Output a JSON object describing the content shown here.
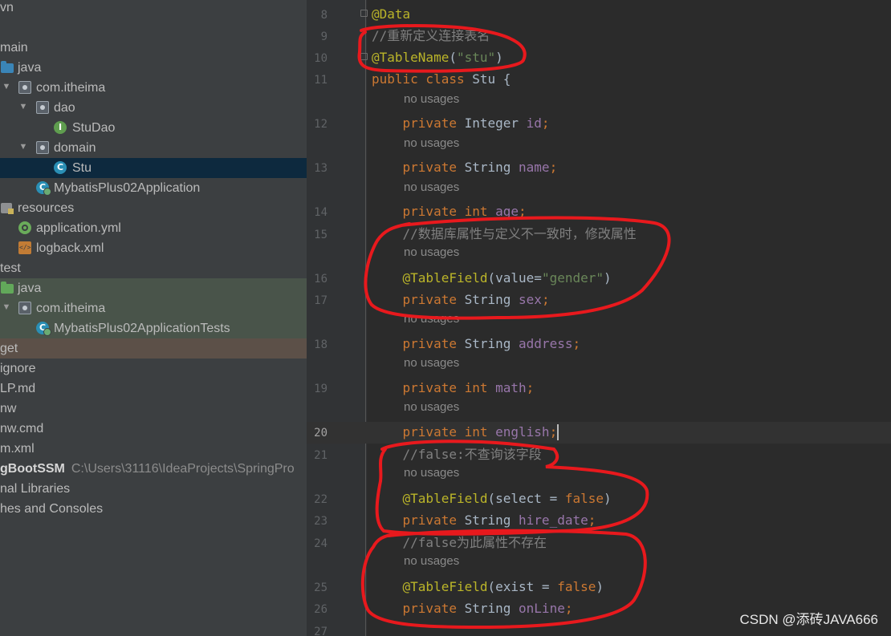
{
  "project_tree": {
    "items": [
      {
        "label": "vn",
        "indent": 0,
        "icon": "none"
      },
      {
        "label": "main",
        "indent": 0,
        "icon": "none"
      },
      {
        "label": "java",
        "icon": "folder-blue-icon"
      },
      {
        "label": "com.itheima",
        "icon": "package-icon"
      },
      {
        "label": "dao",
        "icon": "package-icon"
      },
      {
        "label": "StuDao",
        "icon": "interface-icon",
        "badge": "I"
      },
      {
        "label": "domain",
        "icon": "package-icon"
      },
      {
        "label": "Stu",
        "icon": "class-icon",
        "badge": "C"
      },
      {
        "label": "MybatisPlus02Application",
        "icon": "spring-app-icon",
        "badge": "C"
      },
      {
        "label": "resources",
        "icon": "resources-folder-icon"
      },
      {
        "label": "application.yml",
        "icon": "spring-yml-icon"
      },
      {
        "label": "logback.xml",
        "icon": "xml-file-icon"
      },
      {
        "label": "test",
        "icon": "none"
      },
      {
        "label": "java",
        "icon": "folder-green-icon"
      },
      {
        "label": "com.itheima",
        "icon": "package-icon"
      },
      {
        "label": "MybatisPlus02ApplicationTests",
        "icon": "spring-test-icon",
        "badge": "C"
      },
      {
        "label": "get",
        "icon": "none"
      },
      {
        "label": "ignore",
        "icon": "none"
      },
      {
        "label": "LP.md",
        "icon": "none"
      },
      {
        "label": "nw",
        "icon": "none"
      },
      {
        "label": "nw.cmd",
        "icon": "none"
      },
      {
        "label": "m.xml",
        "icon": "none"
      },
      {
        "label": "gBootSSM",
        "icon": "none",
        "path": "C:\\Users\\31116\\IdeaProjects\\SpringPro"
      },
      {
        "label": "nal Libraries",
        "icon": "none"
      },
      {
        "label": "hes and Consoles",
        "icon": "none"
      }
    ]
  },
  "editor": {
    "hint_text": "no usages",
    "lines": [
      {
        "num": "8",
        "tokens": [
          [
            "ann",
            "@Data"
          ]
        ]
      },
      {
        "num": "9",
        "tokens": [
          [
            "cmt",
            "//重新定义连接表名"
          ]
        ]
      },
      {
        "num": "10",
        "tokens": [
          [
            "ann",
            "@TableName"
          ],
          [
            "typ",
            "("
          ],
          [
            "str",
            "\"stu\""
          ],
          [
            "typ",
            ")"
          ]
        ]
      },
      {
        "num": "11",
        "tokens": [
          [
            "kw",
            "public class "
          ],
          [
            "typ",
            "Stu {"
          ]
        ]
      },
      {
        "num": "12",
        "hint": true,
        "tokens": [
          [
            "typ",
            "    "
          ],
          [
            "kw",
            "private "
          ],
          [
            "typ",
            "Integer "
          ],
          [
            "fld",
            "id"
          ],
          [
            "kw",
            ";"
          ]
        ]
      },
      {
        "num": "13",
        "hint": true,
        "tokens": [
          [
            "typ",
            "    "
          ],
          [
            "kw",
            "private "
          ],
          [
            "typ",
            "String "
          ],
          [
            "fld",
            "name"
          ],
          [
            "kw",
            ";"
          ]
        ]
      },
      {
        "num": "14",
        "hint": true,
        "tokens": [
          [
            "typ",
            "    "
          ],
          [
            "kw",
            "private int "
          ],
          [
            "fld",
            "age"
          ],
          [
            "kw",
            ";"
          ]
        ]
      },
      {
        "num": "15",
        "tokens": [
          [
            "cmt",
            "    //数据库属性与定义不一致时，修改属性"
          ]
        ]
      },
      {
        "num": "16",
        "hint": true,
        "tokens": [
          [
            "typ",
            "    "
          ],
          [
            "ann",
            "@TableField"
          ],
          [
            "typ",
            "(value="
          ],
          [
            "str",
            "\"gender\""
          ],
          [
            "typ",
            ")"
          ]
        ]
      },
      {
        "num": "17",
        "tokens": [
          [
            "typ",
            "    "
          ],
          [
            "kw",
            "private "
          ],
          [
            "typ",
            "String "
          ],
          [
            "fld",
            "sex"
          ],
          [
            "kw",
            ";"
          ]
        ]
      },
      {
        "num": "18",
        "hint": true,
        "tokens": [
          [
            "typ",
            "    "
          ],
          [
            "kw",
            "private "
          ],
          [
            "typ",
            "String "
          ],
          [
            "fld",
            "address"
          ],
          [
            "kw",
            ";"
          ]
        ]
      },
      {
        "num": "19",
        "hint": true,
        "tokens": [
          [
            "typ",
            "    "
          ],
          [
            "kw",
            "private int "
          ],
          [
            "fld",
            "math"
          ],
          [
            "kw",
            ";"
          ]
        ]
      },
      {
        "num": "20",
        "hint": true,
        "current": true,
        "tokens": [
          [
            "typ",
            "    "
          ],
          [
            "kw",
            "private int "
          ],
          [
            "fld",
            "english"
          ],
          [
            "kw",
            ";"
          ]
        ]
      },
      {
        "num": "21",
        "tokens": [
          [
            "cmt",
            "    //false:不查询该字段"
          ]
        ]
      },
      {
        "num": "22",
        "hint": true,
        "tokens": [
          [
            "typ",
            "    "
          ],
          [
            "ann",
            "@TableField"
          ],
          [
            "typ",
            "(select = "
          ],
          [
            "kw",
            "false"
          ],
          [
            "typ",
            ")"
          ]
        ]
      },
      {
        "num": "23",
        "tokens": [
          [
            "typ",
            "    "
          ],
          [
            "kw",
            "private "
          ],
          [
            "typ",
            "String "
          ],
          [
            "fld",
            "hire_date"
          ],
          [
            "kw",
            ";"
          ]
        ]
      },
      {
        "num": "24",
        "tokens": [
          [
            "cmt",
            "    //false为此属性不存在"
          ]
        ]
      },
      {
        "num": "25",
        "hint": true,
        "tokens": [
          [
            "typ",
            "    "
          ],
          [
            "ann",
            "@TableField"
          ],
          [
            "typ",
            "(exist = "
          ],
          [
            "kw",
            "false"
          ],
          [
            "typ",
            ")"
          ]
        ]
      },
      {
        "num": "26",
        "tokens": [
          [
            "typ",
            "    "
          ],
          [
            "kw",
            "private "
          ],
          [
            "typ",
            "String "
          ],
          [
            "fld",
            "onLine"
          ],
          [
            "kw",
            ";"
          ]
        ]
      },
      {
        "num": "27",
        "tokens": []
      }
    ]
  },
  "watermark": "CSDN @添砖JAVA666",
  "colors": {
    "annotation_highlight": "#e8191d",
    "selected_row": "#0d293e",
    "test_area": "#49544a",
    "excluded_row": "#5c5048"
  }
}
